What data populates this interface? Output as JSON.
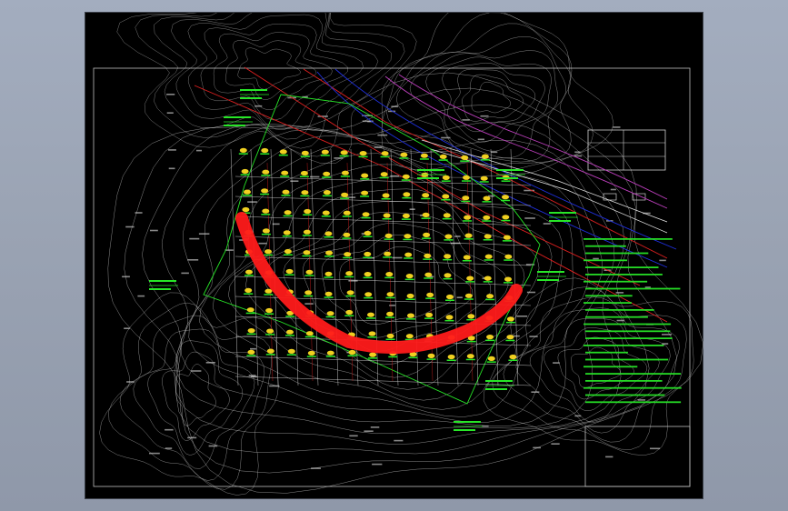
{
  "window": {
    "background": "#9ba4b4",
    "canvas_background": "#000000"
  },
  "title_block": {
    "text": ""
  },
  "legend_table": {
    "header": "",
    "rows": [
      {
        "label": "",
        "value": ""
      },
      {
        "label": "",
        "value": ""
      },
      {
        "label": "",
        "value": ""
      }
    ]
  },
  "colors": {
    "contour": "#cfcfcf",
    "grid": "#e8e8e8",
    "annotation": "#27e627",
    "highlight": "#ff1a1a",
    "red_line": "#e02020",
    "blue_line": "#2030e0",
    "magenta_line": "#c040c0",
    "yellow_marker": "#f0d020",
    "border": "#bfbfbf"
  },
  "icons": [
    "grid-point-marker-icon",
    "callout-flag-icon"
  ]
}
